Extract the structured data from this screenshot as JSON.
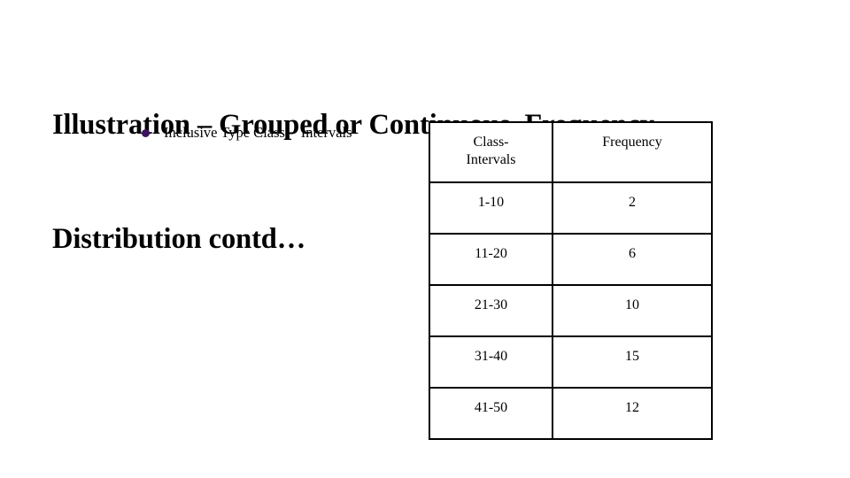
{
  "slide": {
    "title_line1": "Illustration – Grouped or Continuous  Frequency",
    "title_line2": "Distribution contd…",
    "bullet": {
      "marker": "square-bullet-icon",
      "marker_color": "#3b1260",
      "text": "Inclusive Type Class -  Intervals"
    }
  },
  "chart_data": {
    "type": "table",
    "title": "Inclusive Type Class -  Intervals",
    "columns": [
      "Class-Intervals",
      "Frequency"
    ],
    "column_header_lines": [
      [
        "Class-",
        "Intervals"
      ],
      [
        "Frequency"
      ]
    ],
    "categories": [
      "1-10",
      "11-20",
      "21-30",
      "31-40",
      "41-50"
    ],
    "values": [
      2,
      6,
      10,
      15,
      12
    ],
    "rows": [
      [
        "1-10",
        "2"
      ],
      [
        "11-20",
        "6"
      ],
      [
        "21-30",
        "10"
      ],
      [
        "31-40",
        "15"
      ],
      [
        "41-50",
        "12"
      ]
    ],
    "xlabel": "Class-Intervals",
    "ylabel": "Frequency"
  }
}
